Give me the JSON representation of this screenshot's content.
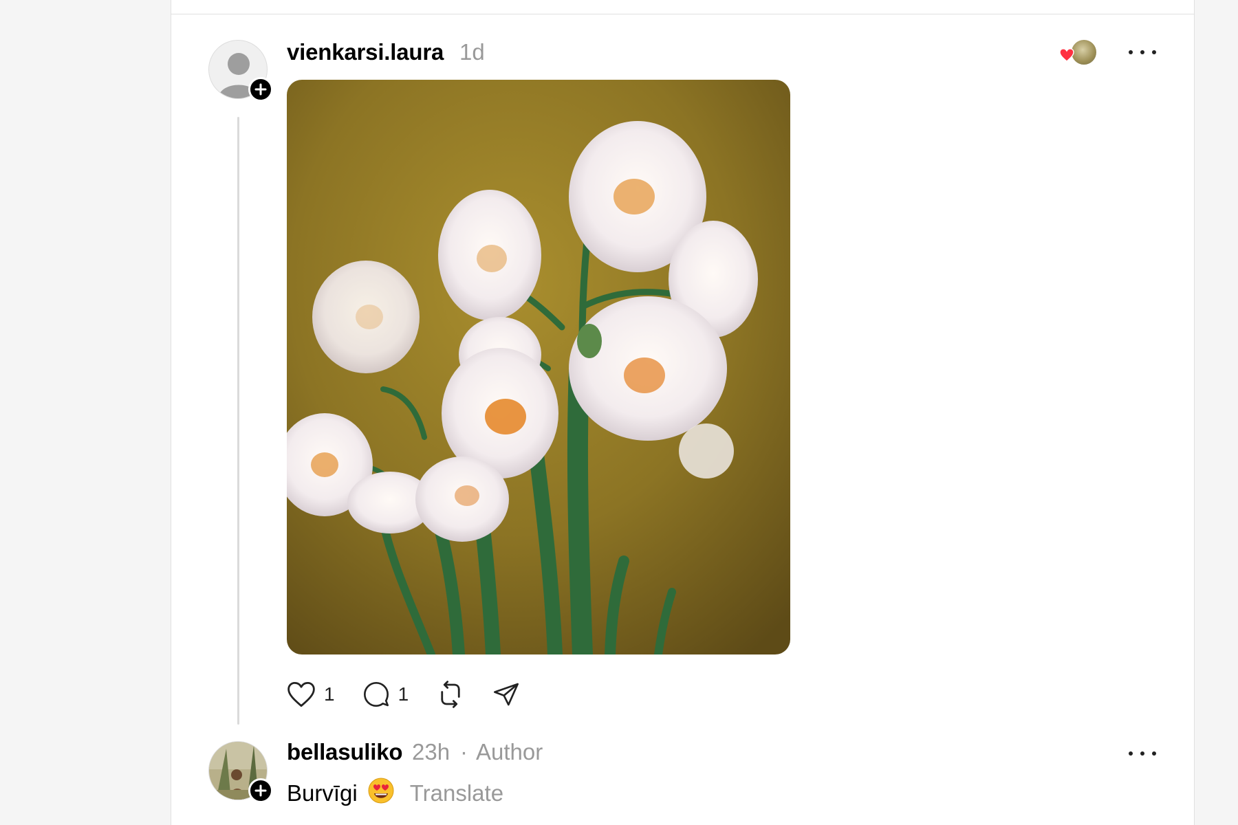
{
  "post": {
    "username": "vienkarsi.laura",
    "time": "1d",
    "likes": "1",
    "replies": "1"
  },
  "reply": {
    "username": "bellasuliko",
    "time": "23h",
    "separator": "·",
    "author_label": "Author",
    "text": "Burvīgi",
    "translate_label": "Translate"
  },
  "icons": [
    "plus-icon",
    "heart-icon",
    "comment-icon",
    "repost-icon",
    "share-icon",
    "more-icon"
  ],
  "colors": {
    "like_red": "#ff3040",
    "muted": "#999999",
    "divider": "#e0e0e0"
  }
}
